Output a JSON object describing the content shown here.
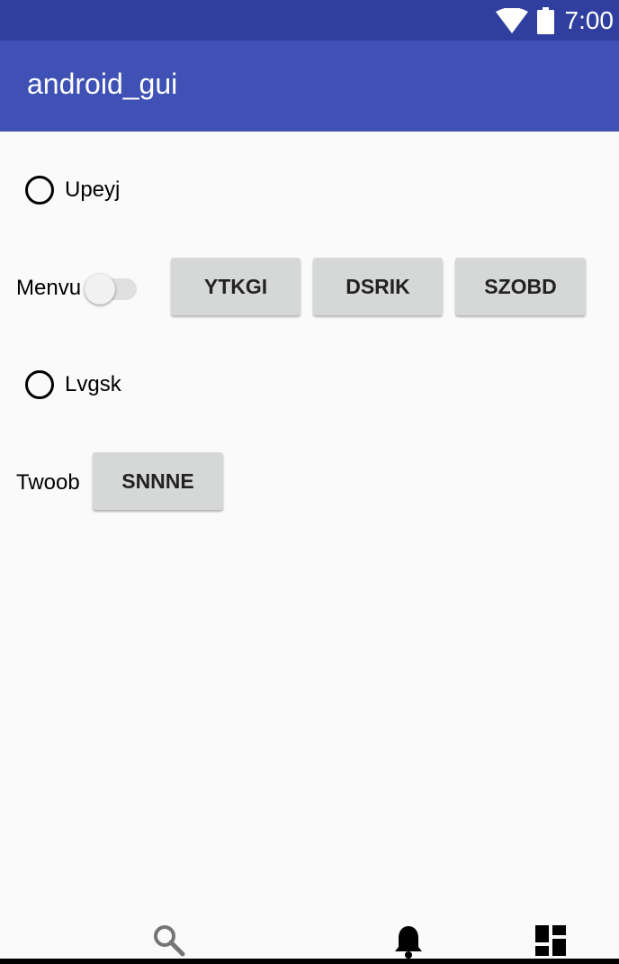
{
  "status_bar": {
    "time": "7:00",
    "icons": [
      "wifi-icon",
      "battery-icon"
    ],
    "color": "#303f9f"
  },
  "app_bar": {
    "title": "android_gui",
    "color": "#3f51b5"
  },
  "content": {
    "radio_1": {
      "label": "Upeyj",
      "checked": false
    },
    "switch_row": {
      "label": "Menvu",
      "switch_on": false,
      "buttons": [
        "YTKGI",
        "DSRIK",
        "SZOBD"
      ]
    },
    "radio_2": {
      "label": "Lvgsk",
      "checked": false
    },
    "button_row": {
      "label": "Twoob",
      "button": "SNNNE"
    }
  },
  "bottom_nav": {
    "icons": [
      "search-icon",
      "bell-icon",
      "dashboard-icon"
    ]
  }
}
